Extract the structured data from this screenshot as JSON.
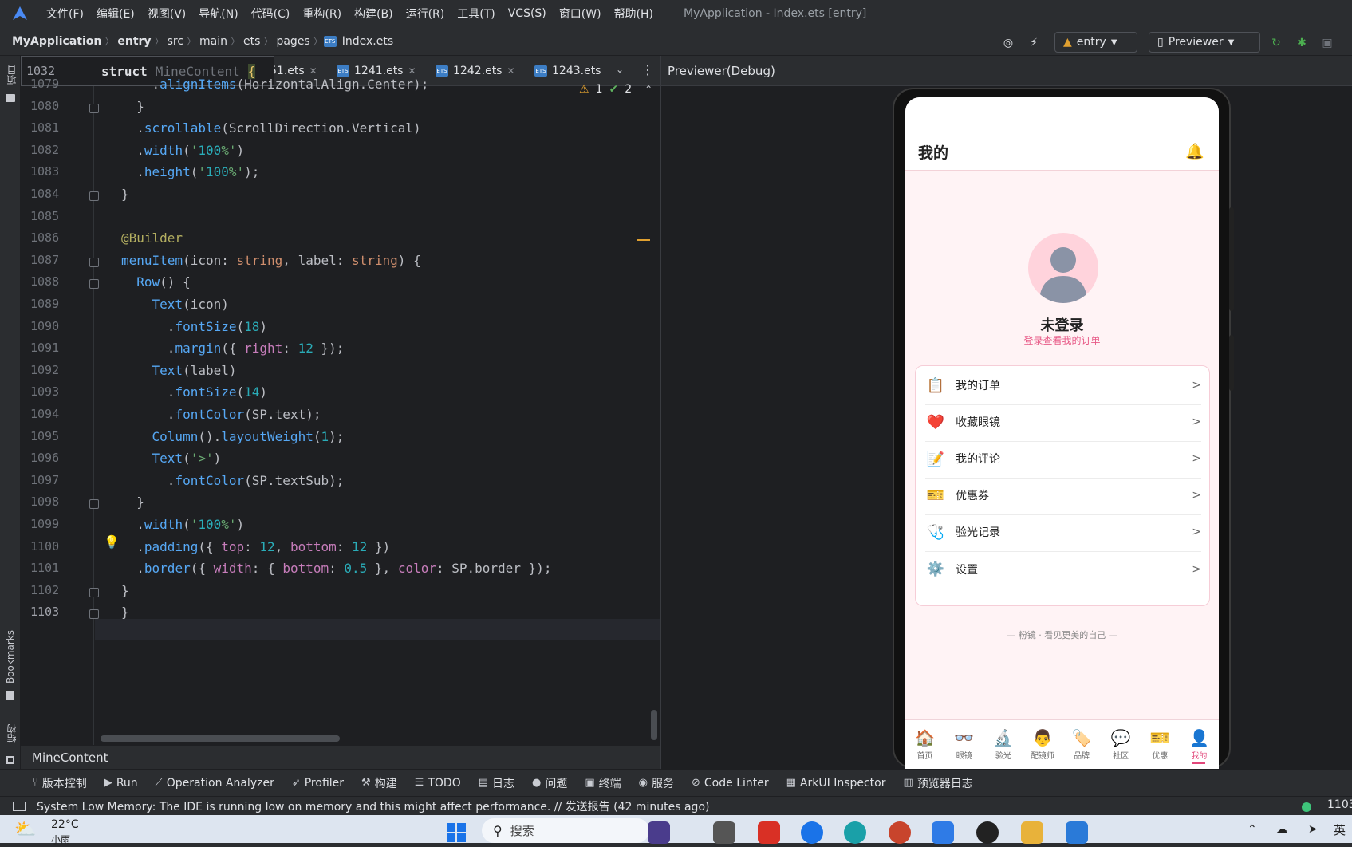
{
  "menu": [
    "文件(F)",
    "编辑(E)",
    "视图(V)",
    "导航(N)",
    "代码(C)",
    "重构(R)",
    "构建(B)",
    "运行(R)",
    "工具(T)",
    "VCS(S)",
    "窗口(W)",
    "帮助(H)"
  ],
  "window_title": "MyApplication - Index.ets [entry]",
  "breadcrumbs": [
    "MyApplication",
    "entry",
    "src",
    "main",
    "ets",
    "pages",
    "Index.ets"
  ],
  "run_config": "entry",
  "device": "Previewer",
  "left_strip": {
    "project": "项目",
    "bookmarks": "Bookmarks",
    "structure": "结构"
  },
  "sticky_header": {
    "line": "1032",
    "keyword": "struct",
    "name": "MineContent",
    "brace": "{"
  },
  "tabs": [
    {
      "name": "51.ets"
    },
    {
      "name": "1241.ets"
    },
    {
      "name": "1242.ets"
    },
    {
      "name": "1243.ets"
    }
  ],
  "inspections": {
    "warnings": "1",
    "ok": "2"
  },
  "code_lines": [
    {
      "n": "1079",
      "t": "    .alignItems(HorizontalAlign.Center);"
    },
    {
      "n": "1080",
      "t": "  }"
    },
    {
      "n": "1081",
      "t": "  .scrollable(ScrollDirection.Vertical)"
    },
    {
      "n": "1082",
      "t": "  .width('100%')"
    },
    {
      "n": "1083",
      "t": "  .height('100%');"
    },
    {
      "n": "1084",
      "t": "}"
    },
    {
      "n": "1085",
      "t": ""
    },
    {
      "n": "1086",
      "t": "@Builder"
    },
    {
      "n": "1087",
      "t": "menuItem(icon: string, label: string) {"
    },
    {
      "n": "1088",
      "t": "  Row() {"
    },
    {
      "n": "1089",
      "t": "    Text(icon)"
    },
    {
      "n": "1090",
      "t": "      .fontSize(18)"
    },
    {
      "n": "1091",
      "t": "      .margin({ right: 12 });"
    },
    {
      "n": "1092",
      "t": "    Text(label)"
    },
    {
      "n": "1093",
      "t": "      .fontSize(14)"
    },
    {
      "n": "1094",
      "t": "      .fontColor(SP.text);"
    },
    {
      "n": "1095",
      "t": "    Column().layoutWeight(1);"
    },
    {
      "n": "1096",
      "t": "    Text('>')"
    },
    {
      "n": "1097",
      "t": "      .fontColor(SP.textSub);"
    },
    {
      "n": "1098",
      "t": "  }"
    },
    {
      "n": "1099",
      "t": "  .width('100%')"
    },
    {
      "n": "1100",
      "t": "  .padding({ top: 12, bottom: 12 })"
    },
    {
      "n": "1101",
      "t": "  .border({ width: { bottom: 0.5 }, color: SP.border });"
    },
    {
      "n": "1102",
      "t": "}"
    },
    {
      "n": "1103",
      "t": "}"
    }
  ],
  "structure_footer": "MineContent",
  "preview": {
    "title": "Previewer(Debug)",
    "app_title": "我的",
    "user_name": "未登录",
    "login_hint": "登录查看我的订单",
    "menu_items": [
      {
        "icon": "📋",
        "label": "我的订单",
        "arrow": ">"
      },
      {
        "icon": "❤️",
        "label": "收藏眼镜",
        "arrow": ">"
      },
      {
        "icon": "📝",
        "label": "我的评论",
        "arrow": ">"
      },
      {
        "icon": "🎫",
        "label": "优惠券",
        "arrow": ">"
      },
      {
        "icon": "🩺",
        "label": "验光记录",
        "arrow": ">"
      },
      {
        "icon": "⚙️",
        "label": "设置",
        "arrow": ">"
      }
    ],
    "slogan": "— 粉镜 · 看见更美的自己 —",
    "tabbar": [
      {
        "icon": "🏠",
        "label": "首页"
      },
      {
        "icon": "👓",
        "label": "眼镜"
      },
      {
        "icon": "🔬",
        "label": "验光"
      },
      {
        "icon": "👨",
        "label": "配镜师"
      },
      {
        "icon": "🏷️",
        "label": "品牌"
      },
      {
        "icon": "💬",
        "label": "社区"
      },
      {
        "icon": "🎫",
        "label": "优惠"
      },
      {
        "icon": "👤",
        "label": "我的",
        "active": true
      }
    ],
    "accent_color": "#e2477a"
  },
  "tool_windows": [
    {
      "icon": "branch-icon",
      "label": "版本控制"
    },
    {
      "icon": "run-icon",
      "label": "Run"
    },
    {
      "icon": "chart-icon",
      "label": "Operation Analyzer"
    },
    {
      "icon": "profiler-icon",
      "label": "Profiler"
    },
    {
      "icon": "hammer-icon",
      "label": "构建"
    },
    {
      "icon": "list-icon",
      "label": "TODO"
    },
    {
      "icon": "log-icon",
      "label": "日志"
    },
    {
      "icon": "info-icon",
      "label": "问题"
    },
    {
      "icon": "terminal-icon",
      "label": "终端"
    },
    {
      "icon": "service-icon",
      "label": "服务"
    },
    {
      "icon": "linter-icon",
      "label": "Code Linter"
    },
    {
      "icon": "inspector-icon",
      "label": "ArkUI Inspector"
    },
    {
      "icon": "preview-log-icon",
      "label": "预览器日志"
    }
  ],
  "status": {
    "message": "System Low Memory: The IDE is running low on memory and this might affect performance. // 发送报告 (42 minutes ago)",
    "right": "1103"
  },
  "taskbar": {
    "weather": "22°C",
    "weather_sub": "小雨",
    "search_placeholder": "搜索",
    "ime": "英"
  }
}
